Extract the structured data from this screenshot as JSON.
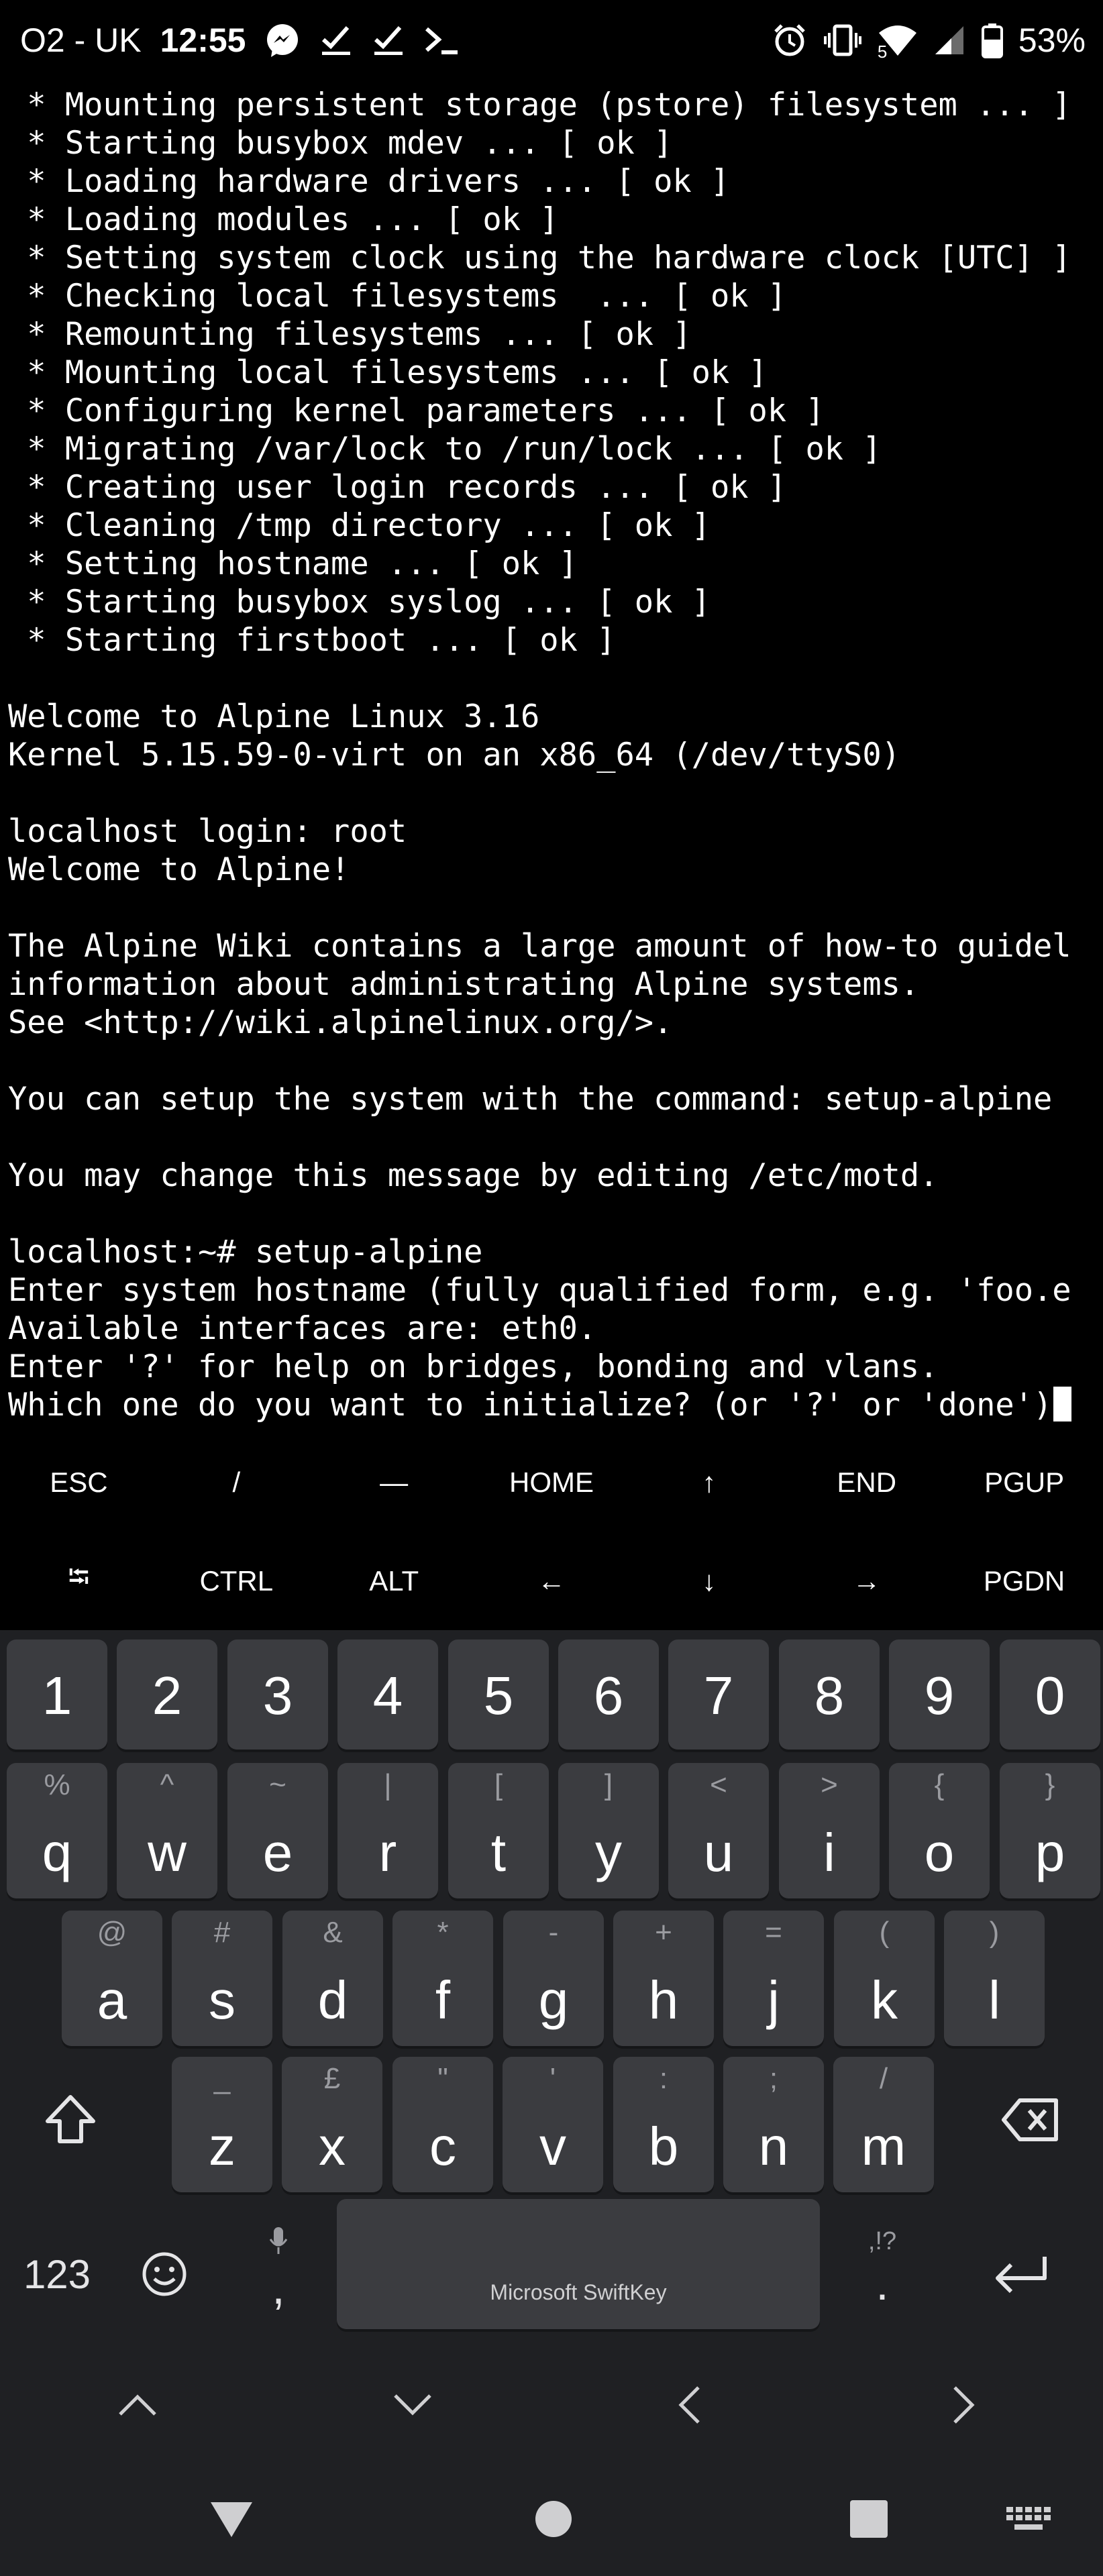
{
  "status_bar": {
    "carrier": "O2 - UK",
    "time": "12:55",
    "battery": "53%",
    "wifi_badge": "5",
    "left_icons": [
      "messenger-icon",
      "check-icon",
      "check-icon",
      "terminal-prompt-icon"
    ],
    "right_icons": [
      "alarm-icon",
      "vibrate-icon",
      "wifi-icon",
      "signal-icon",
      "battery-icon"
    ]
  },
  "terminal": {
    "lines": [
      " * Mounting persistent storage (pstore) filesystem ... ]",
      " * Starting busybox mdev ... [ ok ]",
      " * Loading hardware drivers ... [ ok ]",
      " * Loading modules ... [ ok ]",
      " * Setting system clock using the hardware clock [UTC] ]",
      " * Checking local filesystems  ... [ ok ]",
      " * Remounting filesystems ... [ ok ]",
      " * Mounting local filesystems ... [ ok ]",
      " * Configuring kernel parameters ... [ ok ]",
      " * Migrating /var/lock to /run/lock ... [ ok ]",
      " * Creating user login records ... [ ok ]",
      " * Cleaning /tmp directory ... [ ok ]",
      " * Setting hostname ... [ ok ]",
      " * Starting busybox syslog ... [ ok ]",
      " * Starting firstboot ... [ ok ]",
      "",
      "Welcome to Alpine Linux 3.16",
      "Kernel 5.15.59-0-virt on an x86_64 (/dev/ttyS0)",
      "",
      "localhost login: root",
      "Welcome to Alpine!",
      "",
      "The Alpine Wiki contains a large amount of how-to guidel",
      "information about administrating Alpine systems.",
      "See <http://wiki.alpinelinux.org/>.",
      "",
      "You can setup the system with the command: setup-alpine",
      "",
      "You may change this message by editing /etc/motd.",
      "",
      "localhost:~# setup-alpine",
      "Enter system hostname (fully qualified form, e.g. 'foo.e",
      "Available interfaces are: eth0.",
      "Enter '?' for help on bridges, bonding and vlans.",
      "Which one do you want to initialize? (or '?' or 'done')"
    ]
  },
  "extra_keys": {
    "row1": [
      "ESC",
      "/",
      "—",
      "HOME",
      "↑",
      "END",
      "PGUP"
    ],
    "row2": [
      "⭾",
      "CTRL",
      "ALT",
      "←",
      "↓",
      "→",
      "PGDN"
    ]
  },
  "keyboard": {
    "numbers": [
      "1",
      "2",
      "3",
      "4",
      "5",
      "6",
      "7",
      "8",
      "9",
      "0"
    ],
    "row1": [
      {
        "key": "q",
        "hint": "%"
      },
      {
        "key": "w",
        "hint": "^"
      },
      {
        "key": "e",
        "hint": "~"
      },
      {
        "key": "r",
        "hint": "|"
      },
      {
        "key": "t",
        "hint": "["
      },
      {
        "key": "y",
        "hint": "]"
      },
      {
        "key": "u",
        "hint": "<"
      },
      {
        "key": "i",
        "hint": ">"
      },
      {
        "key": "o",
        "hint": "{"
      },
      {
        "key": "p",
        "hint": "}"
      }
    ],
    "row2": [
      {
        "key": "a",
        "hint": "@"
      },
      {
        "key": "s",
        "hint": "#"
      },
      {
        "key": "d",
        "hint": "&"
      },
      {
        "key": "f",
        "hint": "*"
      },
      {
        "key": "g",
        "hint": "-"
      },
      {
        "key": "h",
        "hint": "+"
      },
      {
        "key": "j",
        "hint": "="
      },
      {
        "key": "k",
        "hint": "("
      },
      {
        "key": "l",
        "hint": ")"
      }
    ],
    "row3": [
      {
        "key": "z",
        "hint": "_"
      },
      {
        "key": "x",
        "hint": "£"
      },
      {
        "key": "c",
        "hint": "\""
      },
      {
        "key": "v",
        "hint": "'"
      },
      {
        "key": "b",
        "hint": ":"
      },
      {
        "key": "n",
        "hint": ";"
      },
      {
        "key": "m",
        "hint": "/"
      }
    ],
    "symbols_label": "123",
    "comma": ",",
    "period": ".",
    "period_hint": ",!?",
    "space_label": "Microsoft SwiftKey"
  },
  "colors": {
    "terminal_bg": "#000000",
    "keyboard_bg": "#1f2023",
    "key_bg": "#3b3c40",
    "hint_text": "#9a9ba0"
  }
}
